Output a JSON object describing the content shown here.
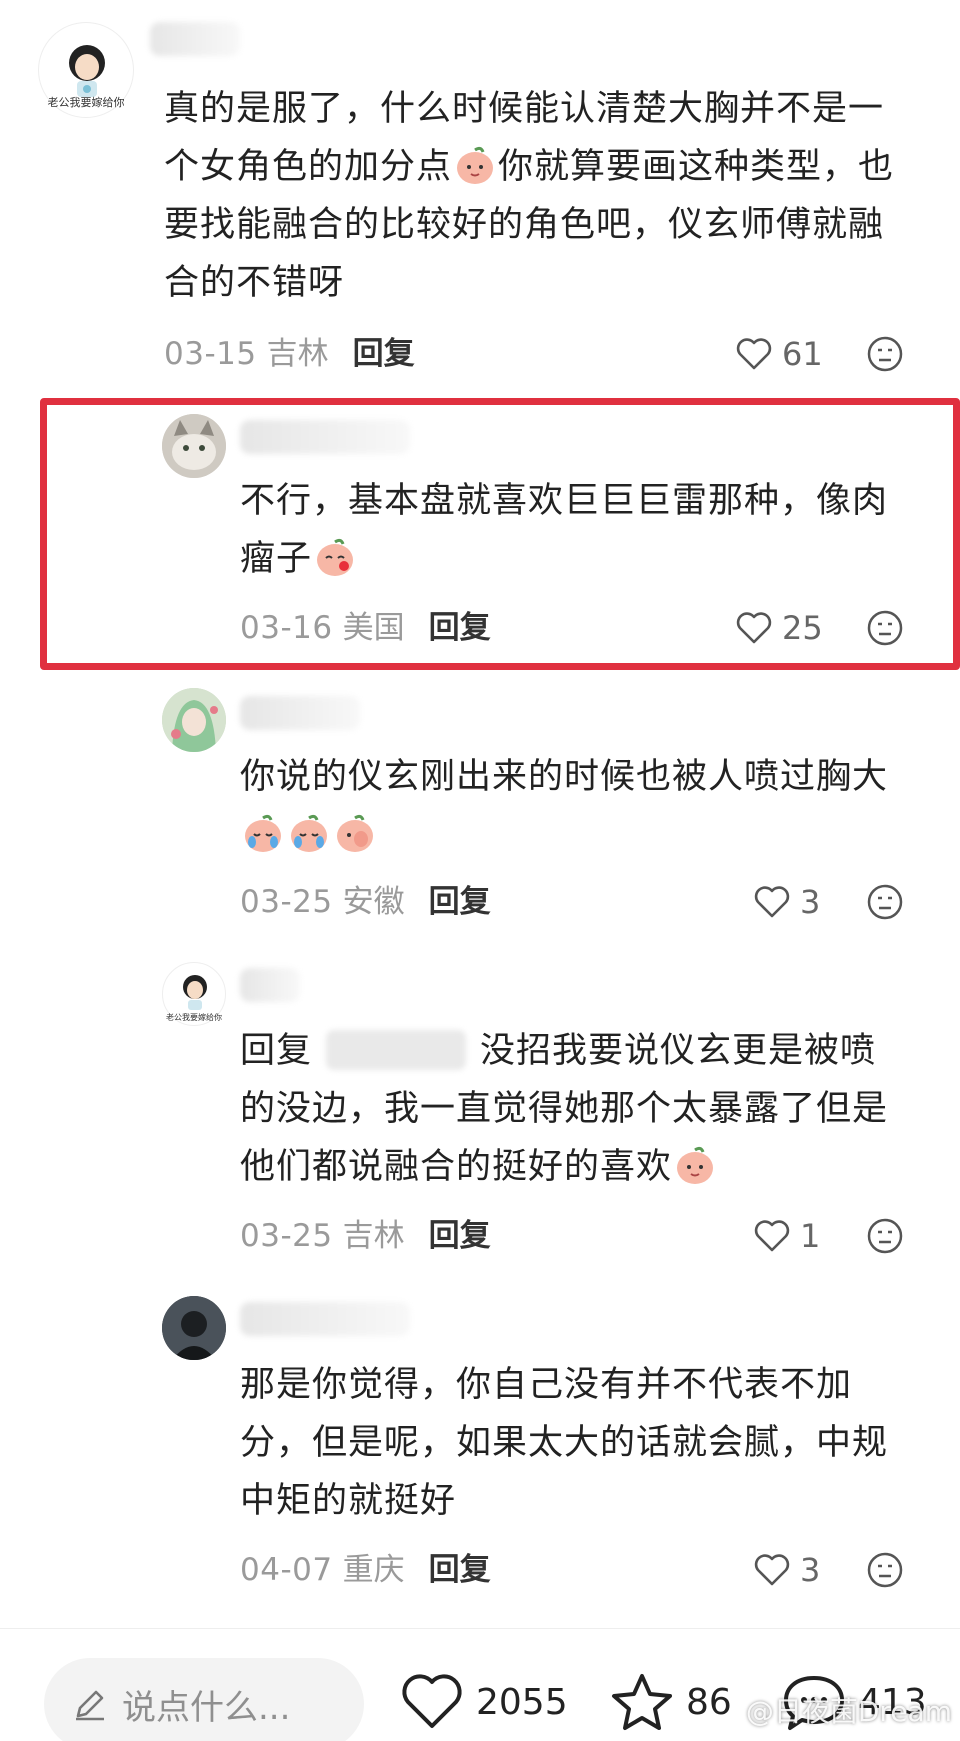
{
  "comments": [
    {
      "lines": [
        "真的是服了，什么时候能认清楚大胸并不是一",
        "个女角色的加分点",
        "你就算要画这种类型，也",
        "要找能融合的比较好的角色吧，仪玄师傅就融",
        "合的不错呀"
      ],
      "date": "03-15",
      "region": "吉林",
      "reply_label": "回复",
      "likes": "61",
      "avatar_caption": "老公我要嫁给你"
    },
    {
      "lines": [
        "不行，基本盘就喜欢巨巨巨雷那种，像肉",
        "瘤子"
      ],
      "date": "03-16",
      "region": "美国",
      "reply_label": "回复",
      "likes": "25"
    },
    {
      "lines": [
        "你说的仪玄刚出来的时候也被人喷过胸大"
      ],
      "date": "03-25",
      "region": "安徽",
      "reply_label": "回复",
      "likes": "3"
    },
    {
      "reply_prefix": "回复",
      "lines": [
        "没招我要说仪玄更是被喷",
        "的没边，我一直觉得她那个太暴露了但是",
        "他们都说融合的挺好的喜欢"
      ],
      "date": "03-25",
      "region": "吉林",
      "reply_label": "回复",
      "likes": "1",
      "avatar_caption": "老公我要嫁给你"
    },
    {
      "lines": [
        "那是你觉得，你自己没有并不代表不加",
        "分，但是呢，如果太大的话就会腻，中规",
        "中矩的就挺好"
      ],
      "date": "04-07",
      "region": "重庆",
      "reply_label": "回复",
      "likes": "3"
    }
  ],
  "bottom_bar": {
    "input_placeholder": "说点什么...",
    "likes": "2055",
    "favorites": "86",
    "comments": "413"
  },
  "watermark": "@日夜菌Dream",
  "colors": {
    "highlight": "#e0303f",
    "meta": "#9a9a9a"
  }
}
